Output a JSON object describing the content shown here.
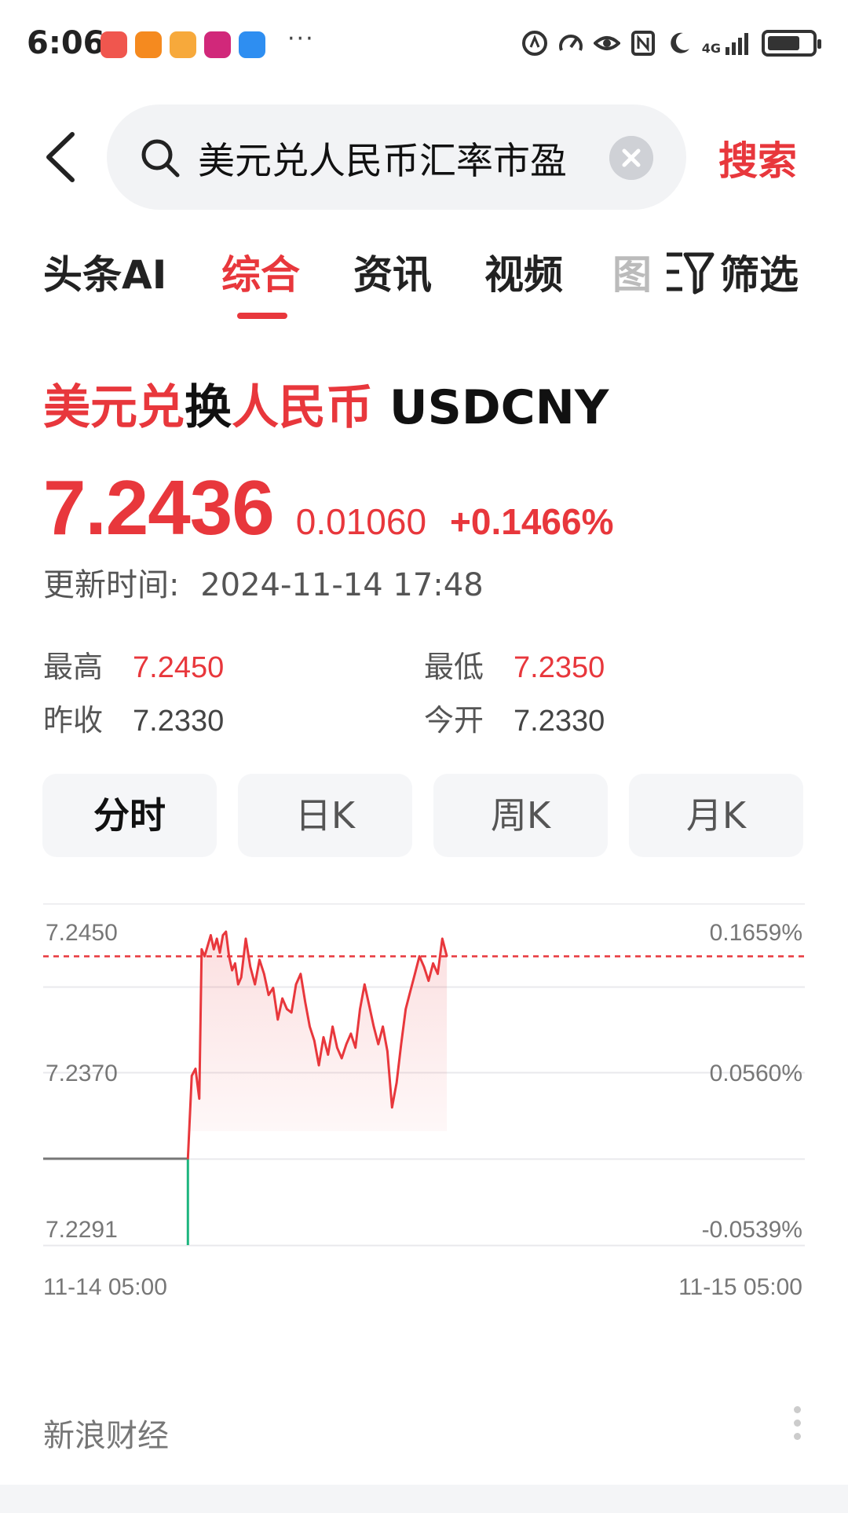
{
  "status_bar": {
    "time": "6:06",
    "more": "···",
    "network": "4G",
    "app_icon_colors": [
      "#f0564e",
      "#f58a1f",
      "#f7a93b",
      "#d1287a",
      "#2e8ef1"
    ],
    "icons": [
      "signal-icon",
      "speed-icon",
      "eye-icon",
      "nfc-icon",
      "moon-icon",
      "battery-icon"
    ]
  },
  "search": {
    "query": "美元兑人民币汇率市盈",
    "button_label": "搜索"
  },
  "tabs": {
    "items": [
      "头条AI",
      "综合",
      "资讯",
      "视频"
    ],
    "partial": "图",
    "active_index": 1,
    "filter_label": "筛选"
  },
  "quote": {
    "title_parts": [
      "美元兑",
      "换",
      "人民币",
      " USDCNY"
    ],
    "price": "7.2436",
    "change": "0.01060",
    "change_pct": "+0.1466%",
    "update_label": "更新时间:",
    "update_time": "2024-11-14 17:48",
    "high_label": "最高",
    "high": "7.2450",
    "low_label": "最低",
    "low": "7.2350",
    "prev_close_label": "昨收",
    "prev_close": "7.2330",
    "open_label": "今开",
    "open": "7.2330"
  },
  "period_tabs": {
    "items": [
      "分时",
      "日K",
      "周K",
      "月K"
    ],
    "active_index": 0
  },
  "chart_data": {
    "type": "line",
    "y_left_ticks": [
      "7.2450",
      "7.2370",
      "7.2291"
    ],
    "y_right_ticks": [
      "0.1659%",
      "0.0560%",
      "-0.0539%"
    ],
    "x_ticks": [
      "11-14 05:00",
      "11-15 05:00"
    ],
    "ylim": [
      7.2291,
      7.245
    ],
    "reference_line": 7.233,
    "dashed_line": 7.2436,
    "line_color": "#e8373c",
    "drop_color": "#1db57e",
    "pre_market_value": 7.233,
    "pre_market_low": 7.2291,
    "series_x_fraction_of_day": [
      0.19,
      0.195,
      0.2,
      0.205,
      0.208,
      0.212,
      0.216,
      0.22,
      0.224,
      0.228,
      0.232,
      0.236,
      0.24,
      0.244,
      0.248,
      0.252,
      0.256,
      0.26,
      0.266,
      0.272,
      0.278,
      0.284,
      0.29,
      0.296,
      0.302,
      0.308,
      0.314,
      0.32,
      0.326,
      0.332,
      0.338,
      0.344,
      0.35,
      0.356,
      0.362,
      0.368,
      0.374,
      0.38,
      0.386,
      0.392,
      0.398,
      0.404,
      0.41,
      0.416,
      0.422,
      0.428,
      0.434,
      0.44,
      0.446,
      0.452,
      0.458,
      0.464,
      0.47,
      0.476,
      0.482,
      0.488,
      0.494,
      0.5,
      0.506,
      0.512,
      0.518,
      0.524,
      0.53
    ],
    "series_values": [
      7.233,
      7.2368,
      7.2372,
      7.2355,
      7.244,
      7.2436,
      7.2442,
      7.2448,
      7.244,
      7.2446,
      7.2438,
      7.2448,
      7.245,
      7.2436,
      7.2428,
      7.2432,
      7.242,
      7.2424,
      7.2446,
      7.243,
      7.242,
      7.2434,
      7.2426,
      7.2414,
      7.2418,
      7.24,
      7.2412,
      7.2406,
      7.2404,
      7.242,
      7.2426,
      7.241,
      7.2396,
      7.2388,
      7.2374,
      7.239,
      7.238,
      7.2396,
      7.2384,
      7.2378,
      7.2386,
      7.2392,
      7.2384,
      7.2406,
      7.242,
      7.2408,
      7.2396,
      7.2386,
      7.2396,
      7.2382,
      7.235,
      7.2364,
      7.2386,
      7.2406,
      7.2416,
      7.2426,
      7.2436,
      7.243,
      7.2422,
      7.2432,
      7.2426,
      7.2446,
      7.2436
    ]
  },
  "footer": {
    "source": "新浪财经"
  }
}
